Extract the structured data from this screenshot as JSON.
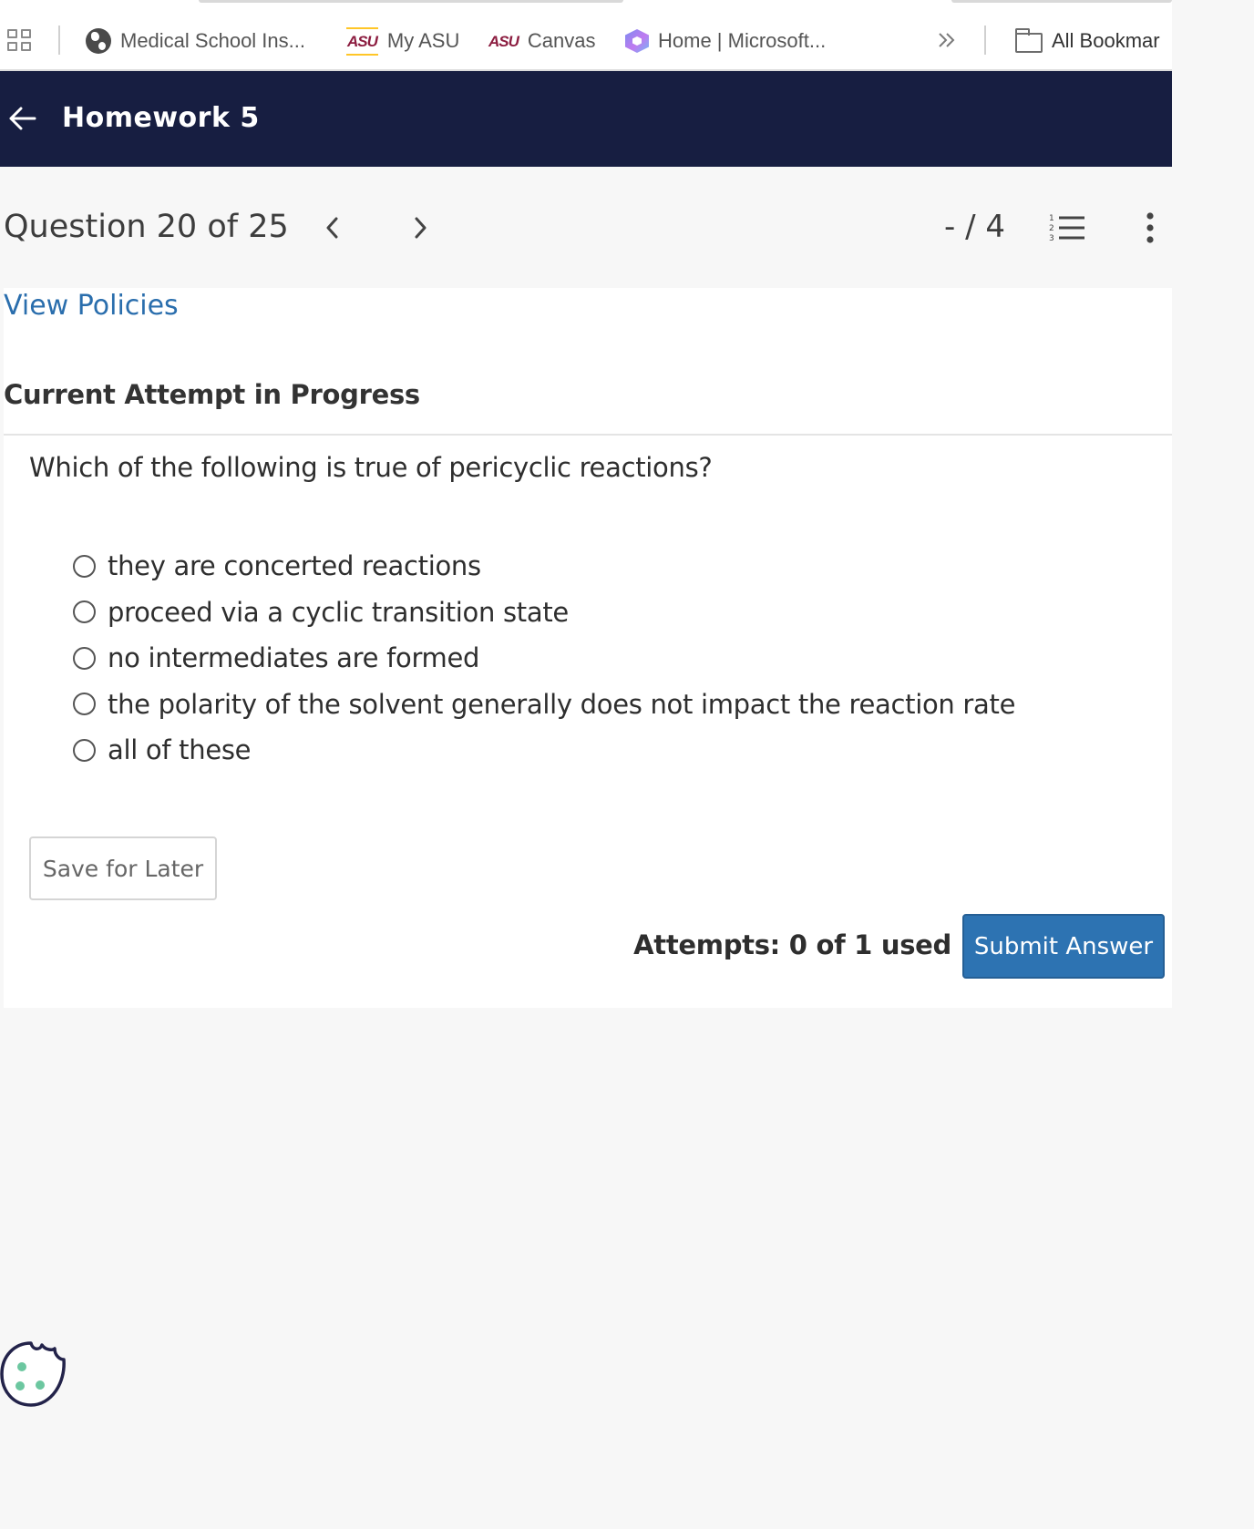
{
  "bookmarks": {
    "items": [
      {
        "label": "Medical School Ins...",
        "icon": "globe-icon"
      },
      {
        "label": "My ASU",
        "icon": "asu-logo-icon"
      },
      {
        "label": "Canvas",
        "icon": "asu-logo-icon"
      },
      {
        "label": "Home | Microsoft...",
        "icon": "microsoft365-icon"
      }
    ],
    "asu_logo_text": "ASU",
    "overflow_icon": "chevron-double-right-icon",
    "all_bookmarks_label": "All Bookmar"
  },
  "header": {
    "title": "Homework 5",
    "back_icon": "arrow-left-icon",
    "background": "#171e41"
  },
  "question_nav": {
    "counter": "Question 20 of 25",
    "score": "- / 4",
    "prev_icon": "chevron-left-icon",
    "next_icon": "chevron-right-icon",
    "list_icon": "numbered-list-icon",
    "menu_icon": "kebab-menu-icon"
  },
  "content": {
    "view_policies": "View Policies",
    "attempt_heading": "Current Attempt in Progress",
    "question": "Which of the following is true of pericyclic reactions?",
    "options": [
      "they are concerted reactions",
      "proceed via a cyclic transition state",
      "no intermediates are formed",
      "the polarity of the solvent generally does not impact the reaction rate",
      "all of these"
    ],
    "save_label": "Save for Later",
    "attempts_text": "Attempts: 0 of 1 used",
    "submit_label": "Submit Answer",
    "accent_color": "#2d73b2",
    "link_color": "#2a6ead"
  },
  "cookie_widget": {
    "icon": "cookie-icon"
  }
}
